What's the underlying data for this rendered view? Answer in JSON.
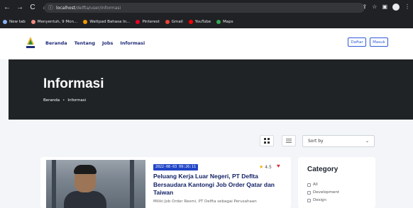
{
  "browser": {
    "url_host": "localhost",
    "url_path": "/delfta/user/informasi",
    "bookmarks": [
      {
        "label": "New tab",
        "icon": "grid-icon",
        "color": "#8ab4f8"
      },
      {
        "label": "Menyentuh, 9 Mon...",
        "icon": "bookmark-icon",
        "color": "#f28b82"
      },
      {
        "label": "Wattpad Bahasa In...",
        "icon": "wattpad-icon",
        "color": "#f29900"
      },
      {
        "label": "Pinterest",
        "icon": "pinterest-icon",
        "color": "#e60023"
      },
      {
        "label": "Gmail",
        "icon": "gmail-icon",
        "color": "#ea4335"
      },
      {
        "label": "YouTube",
        "icon": "youtube-icon",
        "color": "#ff0000"
      },
      {
        "label": "Maps",
        "icon": "maps-icon",
        "color": "#34a853"
      }
    ]
  },
  "nav": {
    "items": [
      "Beranda",
      "Tentang",
      "Jobs",
      "Informasi"
    ],
    "daftar": "Daftar",
    "masuk": "Masuk"
  },
  "hero": {
    "title": "Informasi",
    "breadcrumb_home": "Beranda",
    "breadcrumb_sep": "•",
    "breadcrumb_current": "Informasi"
  },
  "controls": {
    "sort_value": "Sort by"
  },
  "card": {
    "date": "2022-08-03 09:26:11",
    "rating": "4.5",
    "title": "Peluang Kerja Luar Negeri, PT Deflta Bersaudara Kantongi Job Order Qatar dan Taiwan",
    "desc": "Miliki Job Order Resmi, PT Delfta sebagai Perusahaan"
  },
  "sidebar": {
    "title": "Category",
    "items": [
      "All",
      "Development",
      "Design"
    ]
  },
  "colors": {
    "accent": "#2145c7",
    "nav_text": "#1e2a78",
    "hero_bg": "#1f2326"
  }
}
